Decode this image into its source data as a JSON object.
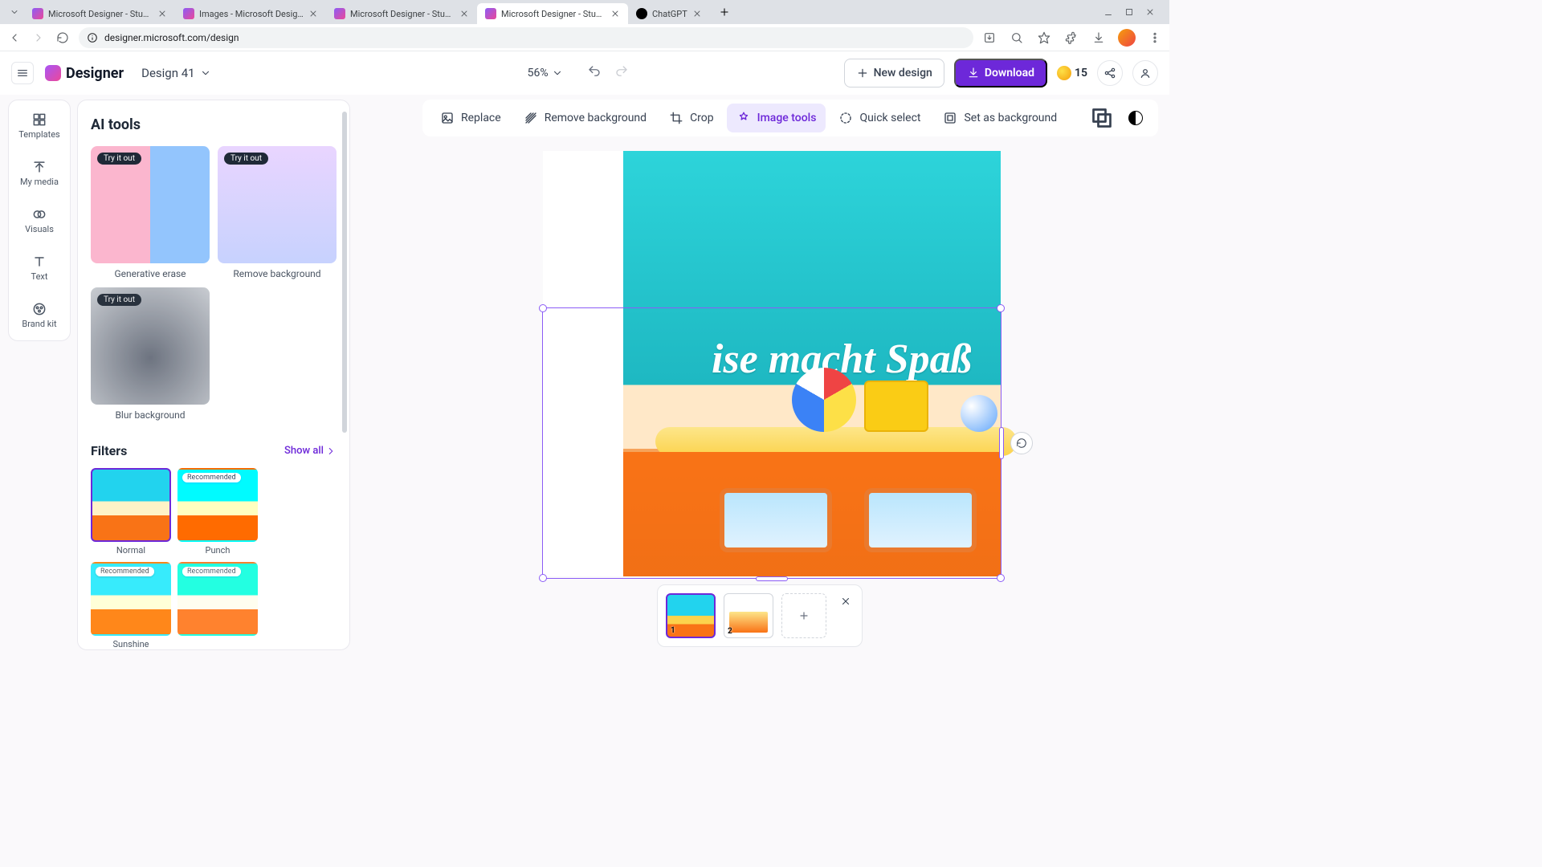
{
  "browser": {
    "tabs": [
      {
        "title": "Microsoft Designer - Stunning"
      },
      {
        "title": "Images - Microsoft Designer"
      },
      {
        "title": "Microsoft Designer - Stunning"
      },
      {
        "title": "Microsoft Designer - Stunning"
      },
      {
        "title": "ChatGPT"
      }
    ],
    "active_tab": 3,
    "url": "designer.microsoft.com/design"
  },
  "header": {
    "logo": "Designer",
    "design_name": "Design 41",
    "zoom": "56%",
    "new_design": "New design",
    "download": "Download",
    "credits": "15"
  },
  "leftnav": {
    "items": [
      {
        "label": "Templates"
      },
      {
        "label": "My media"
      },
      {
        "label": "Visuals"
      },
      {
        "label": "Text"
      },
      {
        "label": "Brand kit"
      }
    ]
  },
  "sidepanel": {
    "ai_tools_title": "AI tools",
    "try_it_out": "Try it out",
    "ai_tools": [
      {
        "label": "Generative erase"
      },
      {
        "label": "Remove background"
      },
      {
        "label": "Blur background"
      }
    ],
    "filters_title": "Filters",
    "show_all": "Show all",
    "recommended": "Recommended",
    "filters": [
      {
        "label": "Normal"
      },
      {
        "label": "Punch"
      },
      {
        "label": "Sunshine"
      }
    ]
  },
  "toolbar": {
    "replace": "Replace",
    "remove_bg": "Remove background",
    "crop": "Crop",
    "image_tools": "Image tools",
    "quick_select": "Quick select",
    "set_bg": "Set as background"
  },
  "canvas": {
    "text": "ise macht Spaß"
  },
  "pages": {
    "p1": "1",
    "p2": "2"
  }
}
